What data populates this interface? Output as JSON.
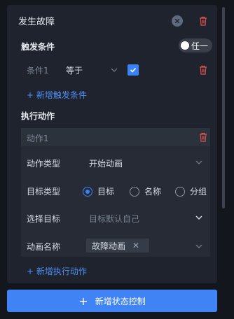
{
  "state": {
    "title": "发生故障",
    "trigger": {
      "section_title": "触发条件",
      "toggle_label": "任一",
      "condition_label": "条件1",
      "operator": "等于",
      "checkbox_checked": true,
      "add_label": "+ 新增触发条件"
    },
    "action": {
      "section_title": "执行动作",
      "header_label": "动作1",
      "type_label": "动作类型",
      "type_value": "开始动画",
      "target_type_label": "目标类型",
      "target_type_options": [
        "目标",
        "名称",
        "分组"
      ],
      "target_type_selected": "目标",
      "select_target_label": "选择目标",
      "select_target_placeholder": "目标默认自己",
      "animation_name_label": "动画名称",
      "animation_tag": "故障动画",
      "add_label": "+ 新增执行动作"
    }
  },
  "footer": {
    "add_state_button": "新增状态控制"
  },
  "colors": {
    "accent": "#3f83f4",
    "danger": "#d9534f",
    "panel": "#1e232d",
    "background": "#13161d"
  }
}
